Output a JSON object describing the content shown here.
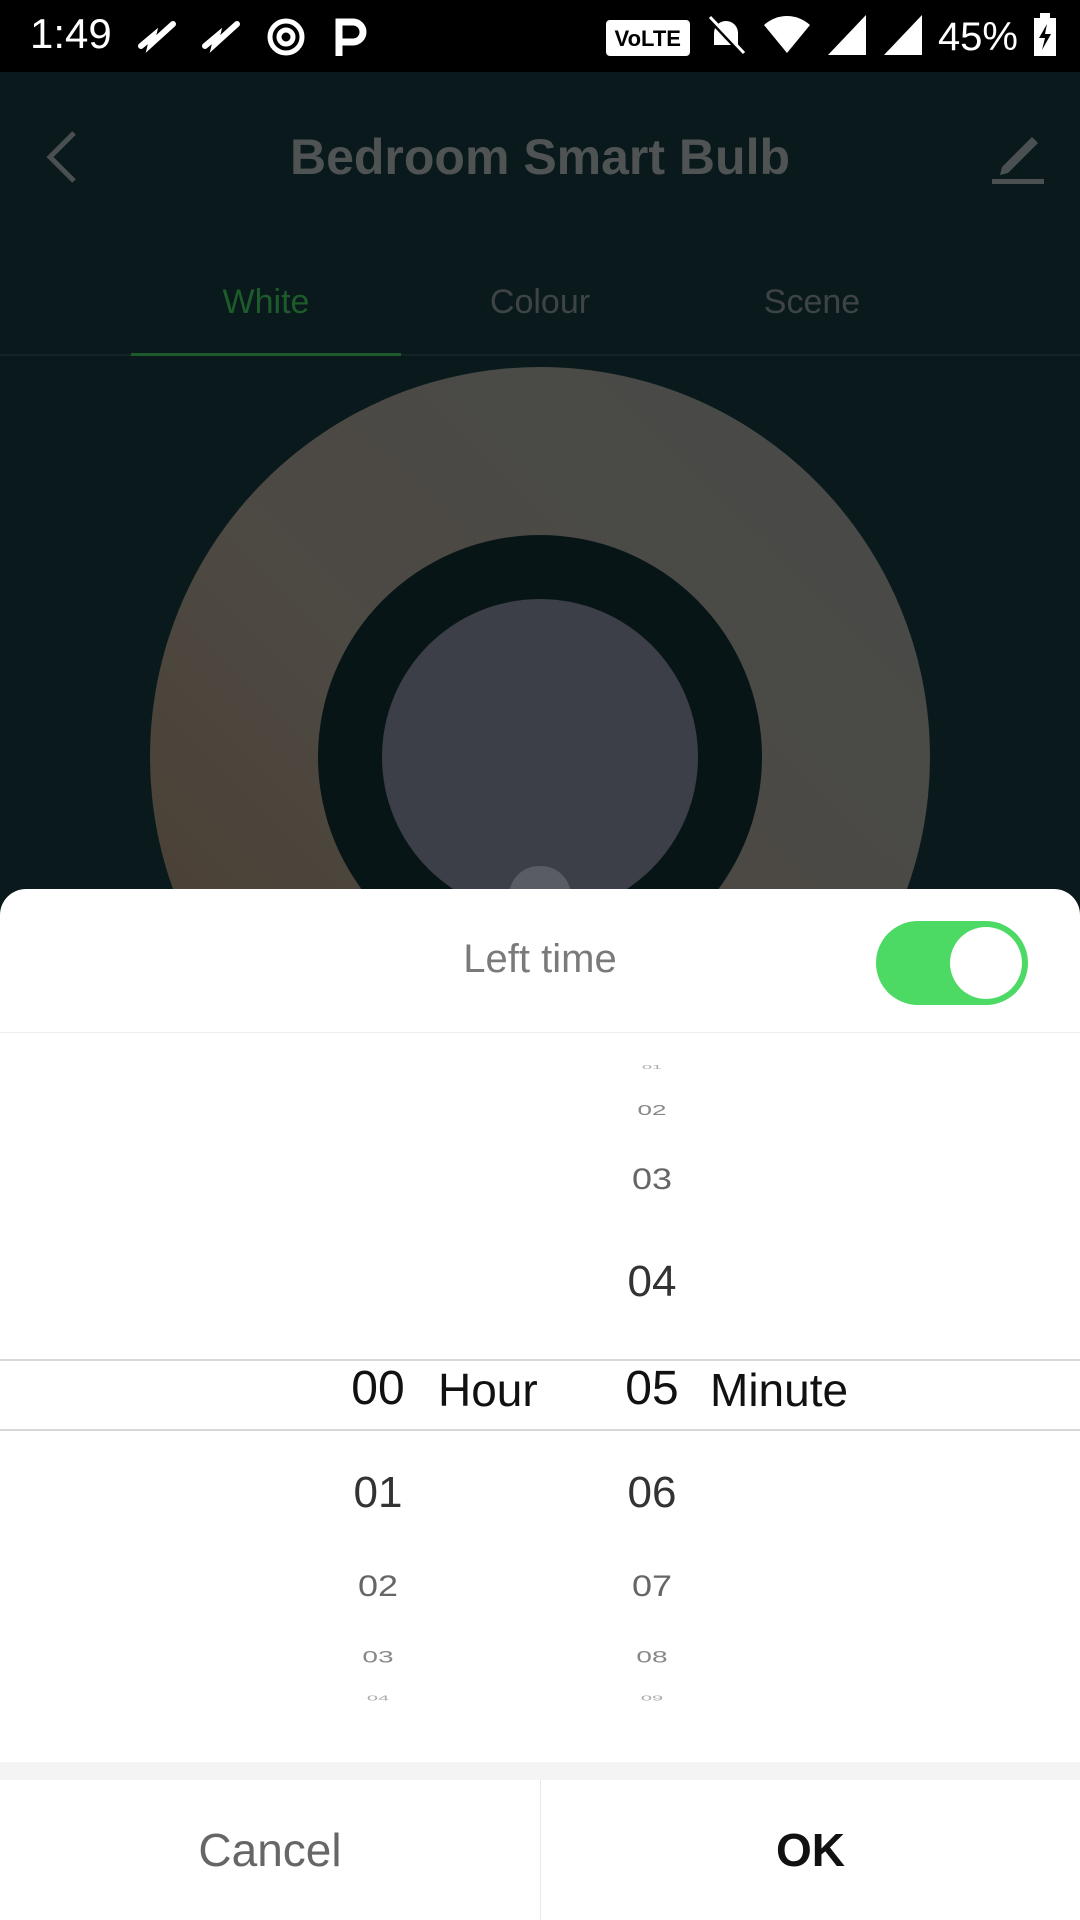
{
  "status_bar": {
    "time": "1:49",
    "network_badge": "VoLTE",
    "battery_percent": "45%",
    "icons": [
      "missed-call-icon",
      "missed-call-icon",
      "sync-icon",
      "parking-icon",
      "mute-bell-icon",
      "wifi-icon",
      "signal-icon",
      "signal-icon",
      "battery-charging-icon"
    ]
  },
  "app": {
    "title": "Bedroom Smart Bulb",
    "tabs": [
      {
        "label": "White"
      },
      {
        "label": "Colour"
      },
      {
        "label": "Scene"
      }
    ],
    "active_tab": "White"
  },
  "dialog": {
    "title": "Left time",
    "toggle_on": true,
    "hour_unit": "Hour",
    "minute_unit": "Minute",
    "hour_items": [
      "00",
      "01",
      "02",
      "03",
      "04"
    ],
    "minute_items": [
      "01",
      "02",
      "03",
      "04",
      "05",
      "06",
      "07",
      "08",
      "09"
    ],
    "selected_hour": "00",
    "selected_minute": "05",
    "cancel_label": "Cancel",
    "ok_label": "OK"
  },
  "colors": {
    "toggle_on": "#4cd964",
    "tab_active": "#1d5b2b"
  }
}
